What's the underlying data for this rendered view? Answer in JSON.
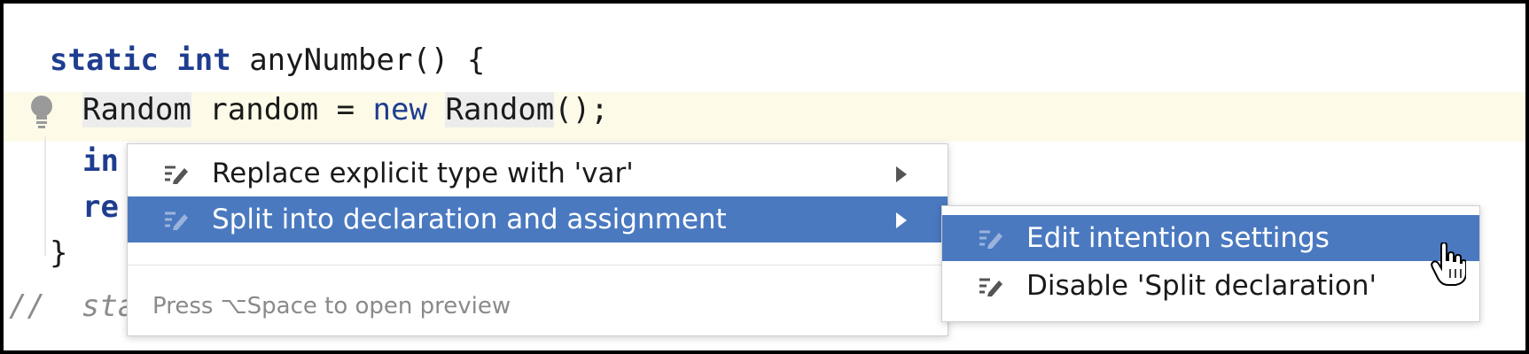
{
  "editor": {
    "lines": [
      {
        "kw1": "static",
        "kw2": "int",
        "rest": " anyNumber() {"
      },
      {
        "t1": "Random",
        "t2": " random = ",
        "kw": "new",
        "t3": "Random",
        "t4": "();"
      },
      {
        "visible": "in",
        "tail": ";"
      },
      {
        "visible": "re"
      },
      {
        "text": "}"
      },
      {
        "comment": "//  static void AnotherMethod() {"
      }
    ]
  },
  "intention_menu": {
    "items": [
      {
        "label": "Replace explicit type with 'var'",
        "icon": "edit-intention-icon"
      },
      {
        "label": "Split into declaration and assignment",
        "icon": "edit-intention-icon"
      }
    ],
    "hint": "Press ⌥Space to open preview"
  },
  "submenu": {
    "items": [
      {
        "label": "Edit intention settings",
        "icon": "edit-intention-icon"
      },
      {
        "label": "Disable 'Split declaration'",
        "icon": "edit-intention-icon"
      }
    ]
  },
  "colors": {
    "selection": "#4a79c0",
    "keyword": "#1f3d8f",
    "line_highlight": "#fdfbe8"
  }
}
